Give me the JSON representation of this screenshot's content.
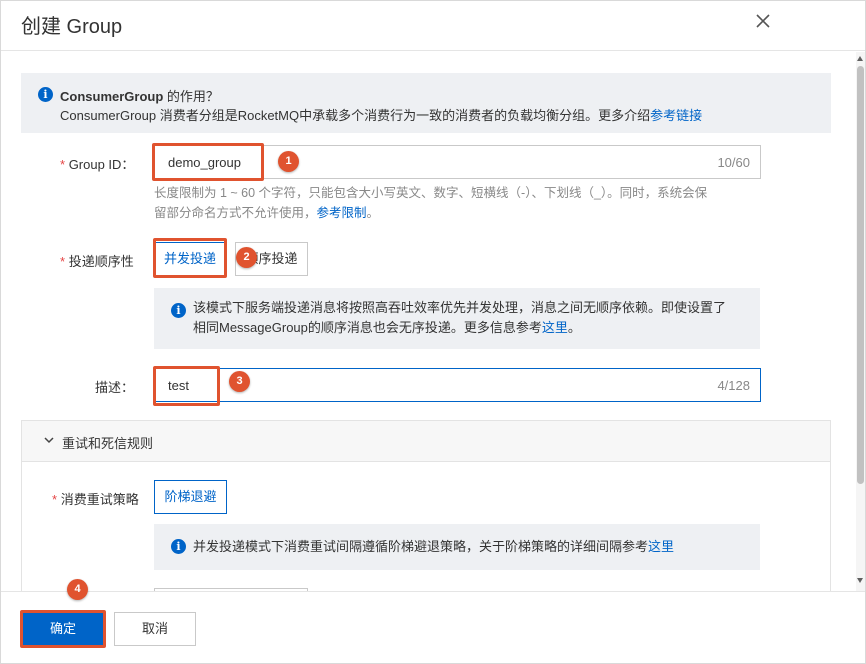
{
  "dialog": {
    "title": "创建 Group",
    "close_icon": "close-icon"
  },
  "info": {
    "title_strong": "ConsumerGroup",
    "title_rest": " 的作用？",
    "text": "ConsumerGroup 消费者分组是RocketMQ中承载多个消费行为一致的消费者的负载均衡分组。更多介绍",
    "link": "参考链接"
  },
  "group_id": {
    "required_mark": "*",
    "label": "Group ID：",
    "value": "demo_group",
    "count": "10/60",
    "help_line1": "长度限制为 1 ~ 60 个字符，只能包含大小写英文、数字、短横线（-）、下划线（_）。同时，系统会保",
    "help_line2": "留部分命名方式不允许使用，",
    "help_link": "参考限制",
    "help_end": "。"
  },
  "delivery": {
    "required_mark": "*",
    "label": "投递顺序性",
    "options": [
      "并发投递",
      "顺序投递"
    ],
    "selected": "并发投递",
    "notice_line1": "该模式下服务端投递消息将按照高吞吐效率优先并发处理，消息之间无顺序依赖。即使设置了",
    "notice_line2": "相同MessageGroup的顺序消息也会无序投递。更多信息参考",
    "notice_link": "这里",
    "notice_end": "。"
  },
  "description": {
    "label": "描述：",
    "value": "test",
    "count": "4/128"
  },
  "retry": {
    "section_title": "重试和死信规则",
    "required_mark": "*",
    "label": "消费重试策略",
    "option": "阶梯退避",
    "notice": "并发投递模式下消费重试间隔遵循阶梯避退策略，关于阶梯策略的详细间隔参考",
    "notice_link": "这里"
  },
  "footer": {
    "ok": "确定",
    "cancel": "取消"
  },
  "markers": [
    "1",
    "2",
    "3",
    "4"
  ],
  "colors": {
    "primary": "#0064c8",
    "annotation": "#e0532f",
    "required": "#e54545"
  }
}
